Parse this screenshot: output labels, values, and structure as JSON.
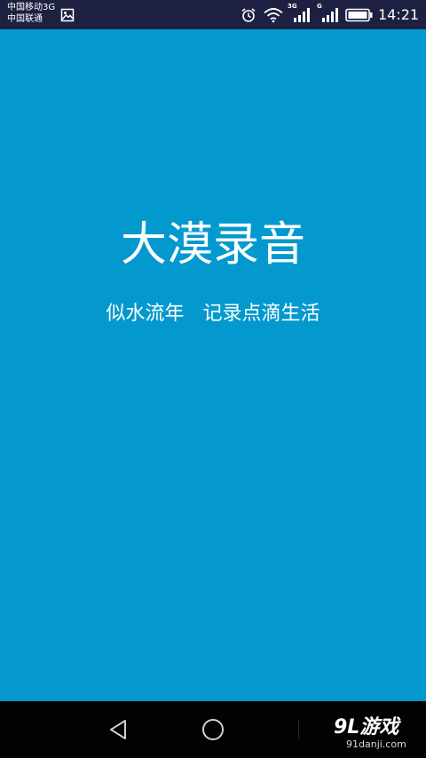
{
  "status_bar": {
    "carrier_1": "中国移动3G",
    "carrier_2": "中国联通",
    "network_1": "3G",
    "network_2": "G",
    "time": "14:21",
    "icons": [
      "gallery-icon",
      "alarm-icon",
      "wifi-icon",
      "signal-icon",
      "signal-icon",
      "battery-icon"
    ]
  },
  "main": {
    "title": "大漠录音",
    "slogan": "似水流年   记录点滴生活",
    "background_color": "#0399cf"
  },
  "nav_bar": {
    "buttons": [
      "back-icon",
      "home-icon"
    ]
  },
  "watermark": {
    "logo": "9L游戏",
    "url": "91danji.com"
  }
}
